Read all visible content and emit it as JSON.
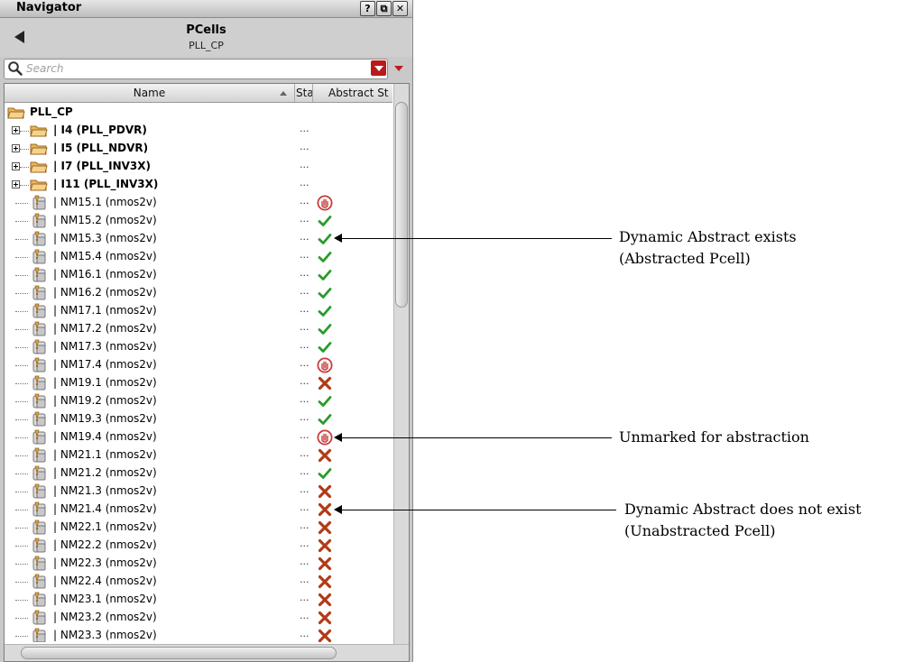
{
  "window": {
    "title": "Navigator",
    "help_label": "?",
    "float_label": "⧉",
    "close_label": "✕"
  },
  "header": {
    "title": "PCells",
    "subtitle": "PLL_CP"
  },
  "search": {
    "placeholder": "Search",
    "value": ""
  },
  "columns": {
    "name": "Name",
    "status": "Sta",
    "abstract_status": "Abstract St"
  },
  "root": {
    "label": "PLL_CP"
  },
  "rows": [
    {
      "label": "| I4  (PLL_PDVR)",
      "kind": "folder",
      "status": "...",
      "abstract": ""
    },
    {
      "label": "| I5  (PLL_NDVR)",
      "kind": "folder",
      "status": "...",
      "abstract": ""
    },
    {
      "label": "| I7  (PLL_INV3X)",
      "kind": "folder",
      "status": "...",
      "abstract": ""
    },
    {
      "label": "| I11  (PLL_INV3X)",
      "kind": "folder",
      "status": "...",
      "abstract": ""
    },
    {
      "label": "| NM15.1  (nmos2v)",
      "kind": "cell",
      "status": "...",
      "abstract": "unmarked"
    },
    {
      "label": "| NM15.2  (nmos2v)",
      "kind": "cell",
      "status": "...",
      "abstract": "exists"
    },
    {
      "label": "| NM15.3  (nmos2v)",
      "kind": "cell",
      "status": "...",
      "abstract": "exists"
    },
    {
      "label": "| NM15.4  (nmos2v)",
      "kind": "cell",
      "status": "...",
      "abstract": "exists"
    },
    {
      "label": "| NM16.1  (nmos2v)",
      "kind": "cell",
      "status": "...",
      "abstract": "exists"
    },
    {
      "label": "| NM16.2  (nmos2v)",
      "kind": "cell",
      "status": "...",
      "abstract": "exists"
    },
    {
      "label": "| NM17.1  (nmos2v)",
      "kind": "cell",
      "status": "...",
      "abstract": "exists"
    },
    {
      "label": "| NM17.2  (nmos2v)",
      "kind": "cell",
      "status": "...",
      "abstract": "exists"
    },
    {
      "label": "| NM17.3  (nmos2v)",
      "kind": "cell",
      "status": "...",
      "abstract": "exists"
    },
    {
      "label": "| NM17.4  (nmos2v)",
      "kind": "cell",
      "status": "...",
      "abstract": "unmarked"
    },
    {
      "label": "| NM19.1  (nmos2v)",
      "kind": "cell",
      "status": "...",
      "abstract": "missing"
    },
    {
      "label": "| NM19.2  (nmos2v)",
      "kind": "cell",
      "status": "...",
      "abstract": "exists"
    },
    {
      "label": "| NM19.3  (nmos2v)",
      "kind": "cell",
      "status": "...",
      "abstract": "exists"
    },
    {
      "label": "| NM19.4  (nmos2v)",
      "kind": "cell",
      "status": "...",
      "abstract": "unmarked"
    },
    {
      "label": "| NM21.1  (nmos2v)",
      "kind": "cell",
      "status": "...",
      "abstract": "missing"
    },
    {
      "label": "| NM21.2  (nmos2v)",
      "kind": "cell",
      "status": "...",
      "abstract": "exists"
    },
    {
      "label": "| NM21.3  (nmos2v)",
      "kind": "cell",
      "status": "...",
      "abstract": "missing"
    },
    {
      "label": "| NM21.4  (nmos2v)",
      "kind": "cell",
      "status": "...",
      "abstract": "missing"
    },
    {
      "label": "| NM22.1  (nmos2v)",
      "kind": "cell",
      "status": "...",
      "abstract": "missing"
    },
    {
      "label": "| NM22.2  (nmos2v)",
      "kind": "cell",
      "status": "...",
      "abstract": "missing"
    },
    {
      "label": "| NM22.3  (nmos2v)",
      "kind": "cell",
      "status": "...",
      "abstract": "missing"
    },
    {
      "label": "| NM22.4  (nmos2v)",
      "kind": "cell",
      "status": "...",
      "abstract": "missing"
    },
    {
      "label": "| NM23.1  (nmos2v)",
      "kind": "cell",
      "status": "...",
      "abstract": "missing"
    },
    {
      "label": "| NM23.2  (nmos2v)",
      "kind": "cell",
      "status": "...",
      "abstract": "missing"
    },
    {
      "label": "| NM23.3  (nmos2v)",
      "kind": "cell",
      "status": "...",
      "abstract": "missing"
    }
  ],
  "icons": {
    "exists": "green-check-icon",
    "missing": "red-x-icon",
    "unmarked": "stop-hand-icon",
    "folder": "folder-icon",
    "cell": "pcell-icon"
  },
  "colors": {
    "check": "#2a9a2a",
    "cross": "#b23a16",
    "stop": "#c83c3c",
    "search_button": "#b81b1b"
  },
  "annotations": {
    "exists": {
      "line1": "Dynamic Abstract exists",
      "line2": "(Abstracted Pcell)"
    },
    "unmarked": {
      "line1": "Unmarked for abstraction"
    },
    "missing": {
      "line1": "Dynamic Abstract does not exist",
      "line2": "(Unabstracted Pcell)"
    }
  }
}
